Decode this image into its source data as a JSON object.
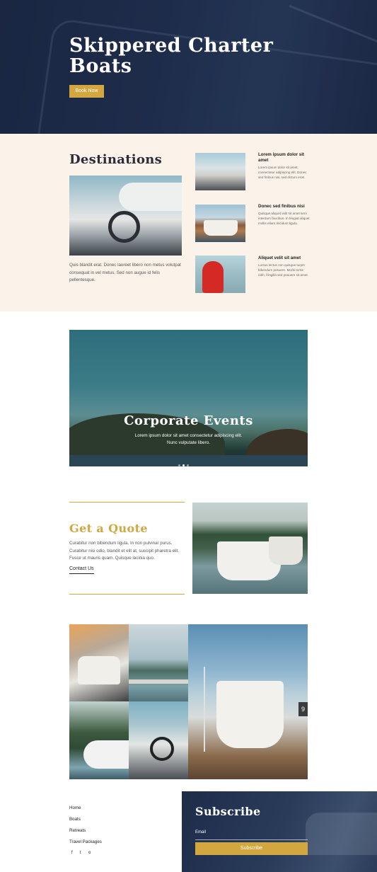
{
  "hero": {
    "title": "Skippered Charter Boats",
    "button_label": "Book Now"
  },
  "destinations": {
    "title": "Destinations",
    "description": "Quis blandit erat. Donec laoreet libero non metus volutpat consequat in vel metus. Sed non augue id felis pellentesque.",
    "items": [
      {
        "title": "Lorem ipsum dolor sit amet",
        "body": "Lorem ipsum dolor sit amet, consectetur adipiscing elit. Donec sed finibus nisi, sed dictum eros."
      },
      {
        "title": "Donec sed finibus nisi",
        "body": "Quisque aliquet velit sit amet sem interdum faucibus. In feugiat aliquet mollis etiam tincidunt ligula."
      },
      {
        "title": "Aliquet velit sit amet",
        "body": "Luctus lectus non quisque turpis bibendum posuere. Morbi tortor nibh, fringilla sed posuere sit amet."
      }
    ]
  },
  "events": {
    "title": "Corporate Events",
    "text_line1": "Lorem ipsum dolor sit amet consectetur adipiscing elit.",
    "text_line2": "Nunc vulputate libero."
  },
  "quote": {
    "title": "Get a Quote",
    "body": "Curabitur non bibendum ligula. In non pulvinar purus. Curabitur nisi odio, blandit et elit at, suscipit pharetra elit. Fusce ut mauris quam. Quisque lacinia quo.",
    "link_label": "Contact Us"
  },
  "footer": {
    "nav": [
      "Home",
      "Boats",
      "Retreats",
      "Travel Packages"
    ],
    "social": [
      "f",
      "t",
      "o"
    ]
  },
  "subscribe": {
    "title": "Subscribe",
    "email_label": "Email",
    "button_label": "Subscribe"
  },
  "gallery": {
    "sign_number": "9"
  },
  "colors": {
    "accent": "#d3a73f",
    "navy": "#1e2c49",
    "cream": "#fbf3ea"
  }
}
